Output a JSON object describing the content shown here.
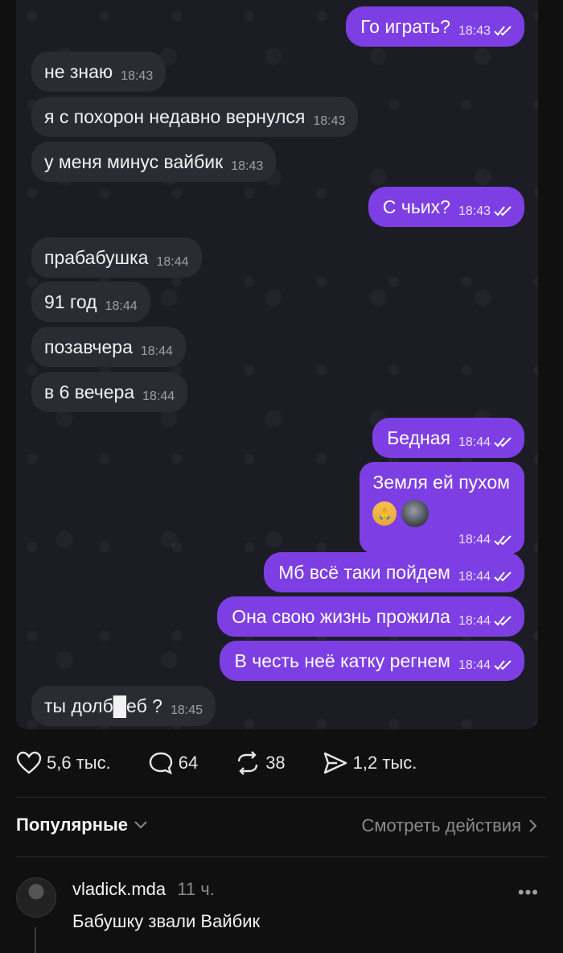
{
  "chat": {
    "messages": [
      {
        "side": "out",
        "text": "Го играть?",
        "time": "18:43"
      },
      {
        "side": "in",
        "text": "не знаю",
        "time": "18:43"
      },
      {
        "side": "in",
        "text": "я с похорон недавно вернулся",
        "time": "18:43"
      },
      {
        "side": "in",
        "text": "у меня минус вайбик",
        "time": "18:43"
      },
      {
        "side": "out",
        "text": "С чьих?",
        "time": "18:43"
      },
      {
        "side": "in",
        "text": "прабабушка",
        "time": "18:44"
      },
      {
        "side": "in",
        "text": "91 год",
        "time": "18:44"
      },
      {
        "side": "in",
        "text": "позавчера",
        "time": "18:44"
      },
      {
        "side": "in",
        "text": "в 6 вечера",
        "time": "18:44"
      },
      {
        "side": "out",
        "text": "Бедная",
        "time": "18:44"
      },
      {
        "side": "out",
        "text": "Земля ей пухом",
        "time": "18:44",
        "emojis": [
          "pray-emoji",
          "sticker-emoji"
        ]
      },
      {
        "side": "out",
        "text": "Мб всё таки пойдем",
        "time": "18:44"
      },
      {
        "side": "out",
        "text": "Она свою жизнь прожила",
        "time": "18:44"
      },
      {
        "side": "out",
        "text": "В честь неё катку регнем",
        "time": "18:44"
      },
      {
        "side": "in",
        "text": "ты долб█еб ?",
        "time": "18:45"
      }
    ]
  },
  "actions": {
    "likes": "5,6 тыс.",
    "comments": "64",
    "reposts": "38",
    "shares": "1,2 тыс."
  },
  "comments_section": {
    "sort_label": "Популярные",
    "see_actions_label": "Смотреть действия"
  },
  "comment": {
    "username": "vladick.mda",
    "time": "11 ч.",
    "text": "Бабушку звали Вайбик",
    "more": "•••"
  },
  "colors": {
    "outgoing_bubble": "#7d3fe3",
    "incoming_bubble": "#2a2c33",
    "background": "#101010"
  }
}
